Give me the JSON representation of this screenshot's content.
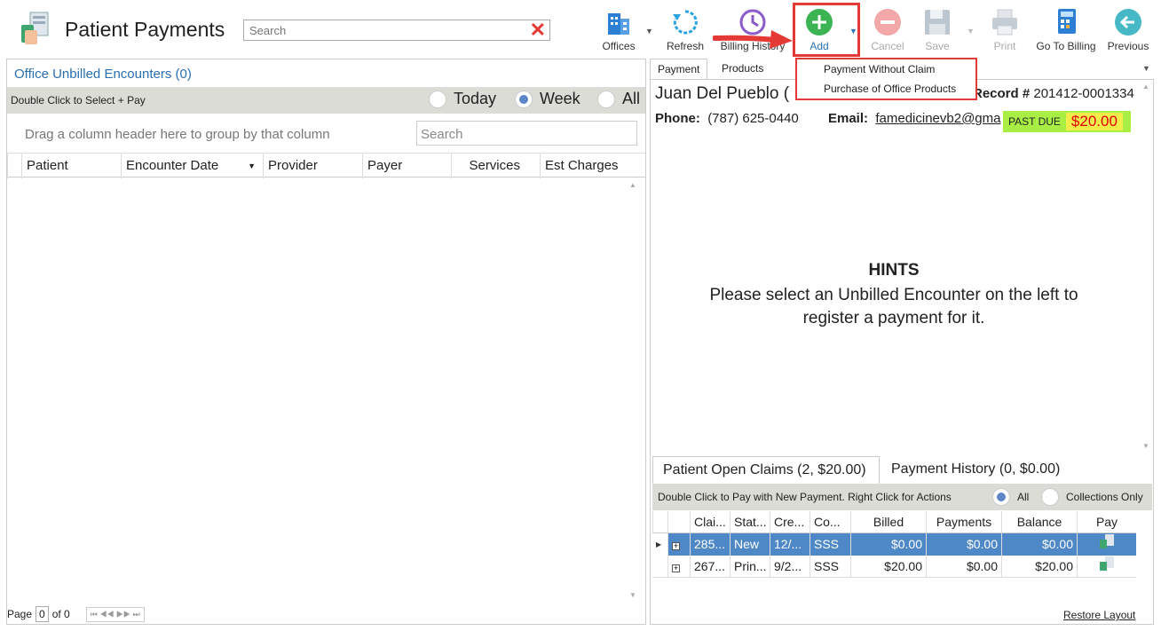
{
  "header": {
    "title": "Patient Payments",
    "search_placeholder": "Search"
  },
  "toolbar": {
    "offices": "Offices",
    "refresh": "Refresh",
    "billing_history": "Billing History",
    "add": "Add",
    "cancel": "Cancel",
    "save": "Save",
    "print": "Print",
    "go_to_billing": "Go To Billing",
    "previous": "Previous"
  },
  "add_menu": {
    "items": [
      "Payment Without Claim",
      "Purchase of Office Products"
    ]
  },
  "left": {
    "title": "Office Unbilled Encounters (0)",
    "bar_text": "Double Click to Select + Pay",
    "radios": [
      {
        "label": "Today",
        "selected": false
      },
      {
        "label": "Week",
        "selected": true
      },
      {
        "label": "All",
        "selected": false
      }
    ],
    "group_hint": "Drag a column header here to group by that column",
    "search_placeholder": "Search",
    "columns": [
      "Patient",
      "Encounter Date",
      "Provider",
      "Payer",
      "Services",
      "Est Charges"
    ],
    "pager": {
      "page_label": "Page",
      "page": "0",
      "of": "of 0"
    }
  },
  "right": {
    "tabs": [
      "Payment",
      "Products"
    ],
    "patient_name": "Juan Del Pueblo (",
    "record_label": "Record #",
    "record_value": "201412-0001334",
    "phone_label": "Phone:",
    "phone_value": "(787) 625-0440",
    "email_label": "Email:",
    "email_value": "famedicinevb2@gma",
    "past_due_label": "PAST DUE",
    "past_due_amount": "$20.00",
    "hints_title": "HINTS",
    "hints_text": "Please select an Unbilled Encounter on the left to register a payment for it."
  },
  "claims": {
    "tab_open": "Patient Open Claims (2, $20.00)",
    "tab_history": "Payment History (0, $0.00)",
    "bar_text": "Double Click to Pay with New Payment. Right Click for Actions",
    "radio_all": "All",
    "radio_collections": "Collections Only",
    "columns": [
      "Clai...",
      "Stat...",
      "Cre...",
      "Co...",
      "Billed",
      "Payments",
      "Balance",
      "Pay"
    ],
    "rows": [
      {
        "claim": "285...",
        "status": "New",
        "created": "12/...",
        "co": "SSS",
        "billed": "$0.00",
        "payments": "$0.00",
        "balance": "$0.00"
      },
      {
        "claim": "267...",
        "status": "Prin...",
        "created": "9/2...",
        "co": "SSS",
        "billed": "$20.00",
        "payments": "$0.00",
        "balance": "$20.00"
      }
    ],
    "restore_layout": "Restore Layout"
  },
  "colors": {
    "accent": "#2a6fb0",
    "highlight": "#e53935",
    "selected_row": "#4f88c6"
  }
}
